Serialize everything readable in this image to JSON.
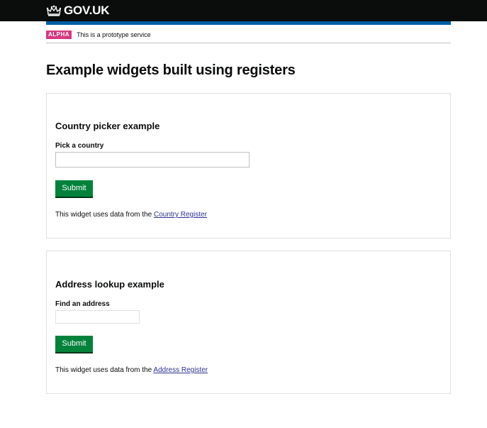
{
  "header": {
    "logo_text": "GOV.UK",
    "logo_icon": "crown-icon",
    "background": "#0b0c0c",
    "accent": "#005ea5"
  },
  "phase_banner": {
    "tag": "ALPHA",
    "text": "This is a prototype service",
    "tag_color": "#d53880"
  },
  "page": {
    "title": "Example widgets built using registers"
  },
  "widgets": [
    {
      "heading": "Country picker example",
      "field_label": "Pick a country",
      "input_value": "",
      "button_label": "Submit",
      "source_prefix": "This widget uses data from the",
      "source_link": "Country Register"
    },
    {
      "heading": "Address lookup example",
      "field_label": "Find an address",
      "input_value": "",
      "button_label": "Submit",
      "source_prefix": "This widget uses data from the",
      "source_link": "Address Register"
    }
  ],
  "colors": {
    "button": "#00823b",
    "link": "#2e3191",
    "panel_border": "#dee0e2"
  }
}
